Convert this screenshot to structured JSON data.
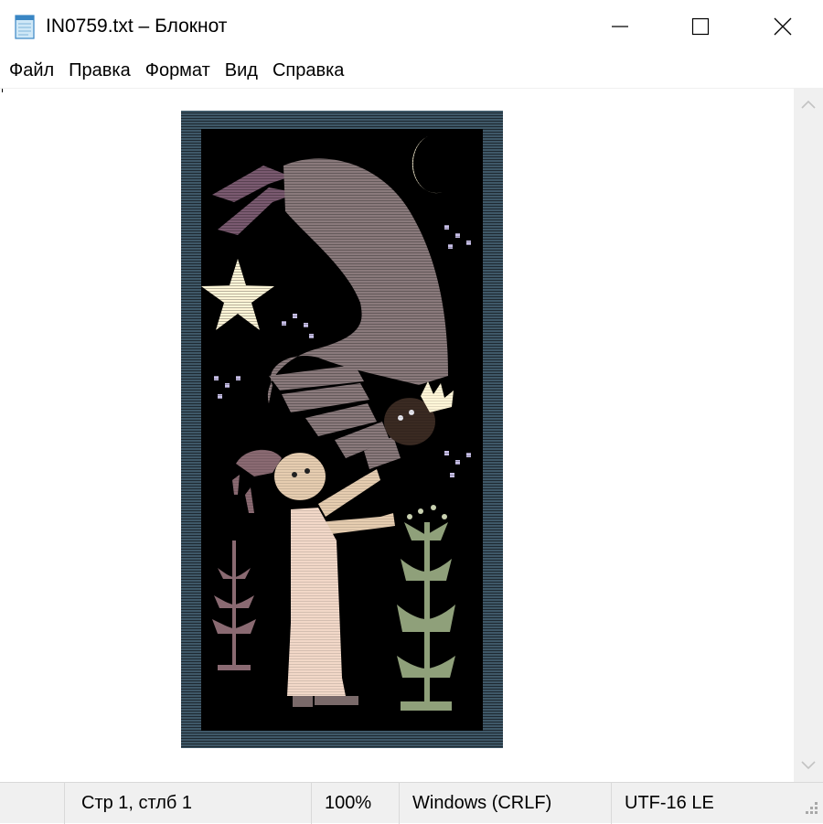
{
  "window": {
    "title": "IN0759.txt – Блокнот",
    "app_icon": "notepad-icon"
  },
  "title_controls": {
    "minimize_icon": "minimize-icon",
    "maximize_icon": "maximize-icon",
    "close_icon": "close-icon"
  },
  "menu": {
    "items": [
      "Файл",
      "Правка",
      "Формат",
      "Вид",
      "Справка"
    ]
  },
  "editor": {
    "content_description_icon": "ascii-art-image",
    "artwork_colors": {
      "frame": "#3f5868",
      "background": "#000000",
      "angel": "#8a7a7c",
      "wings_dark": "#7a5a70",
      "moon_star": "#fff6d8",
      "gown": "#f2d8c8",
      "tree_green": "#8fa07a",
      "tree_mauve": "#8a6a72"
    }
  },
  "scrollbar": {
    "up_icon": "chevron-up-icon",
    "down_icon": "chevron-down-icon"
  },
  "status": {
    "position": "Стр 1, стлб 1",
    "zoom": "100%",
    "line_ending": "Windows (CRLF)",
    "encoding": "UTF-16 LE",
    "grip_icon": "resize-grip-icon"
  }
}
